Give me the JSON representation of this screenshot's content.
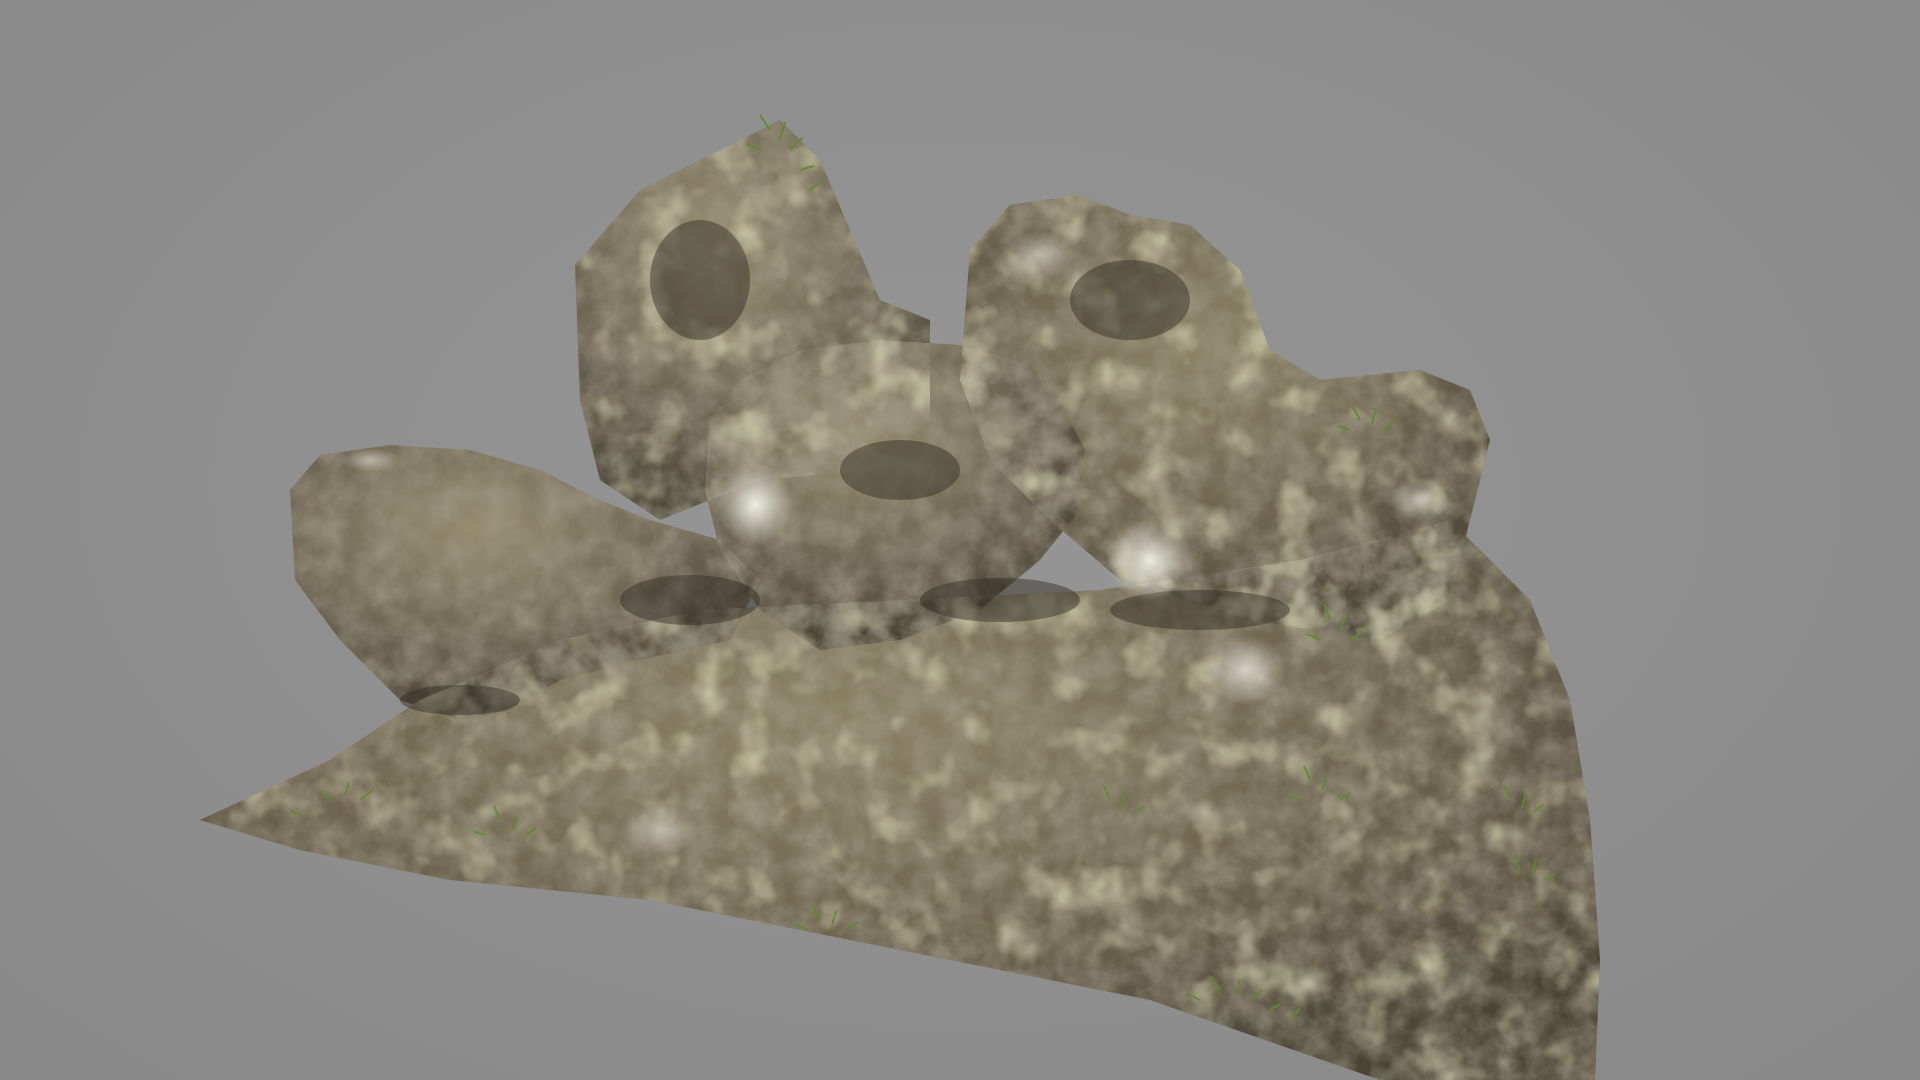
{
  "scene": {
    "subject": "rock-formation-3d-model",
    "background_color": "#8f8f8f",
    "palette": {
      "rock_dark": "#4f4a3c",
      "rock_mid": "#7a6f55",
      "rock_light": "#a59a7c",
      "lichen": "#b7b77a",
      "moss": "#5d7a2e",
      "highlight": "#e6e6dc"
    }
  }
}
